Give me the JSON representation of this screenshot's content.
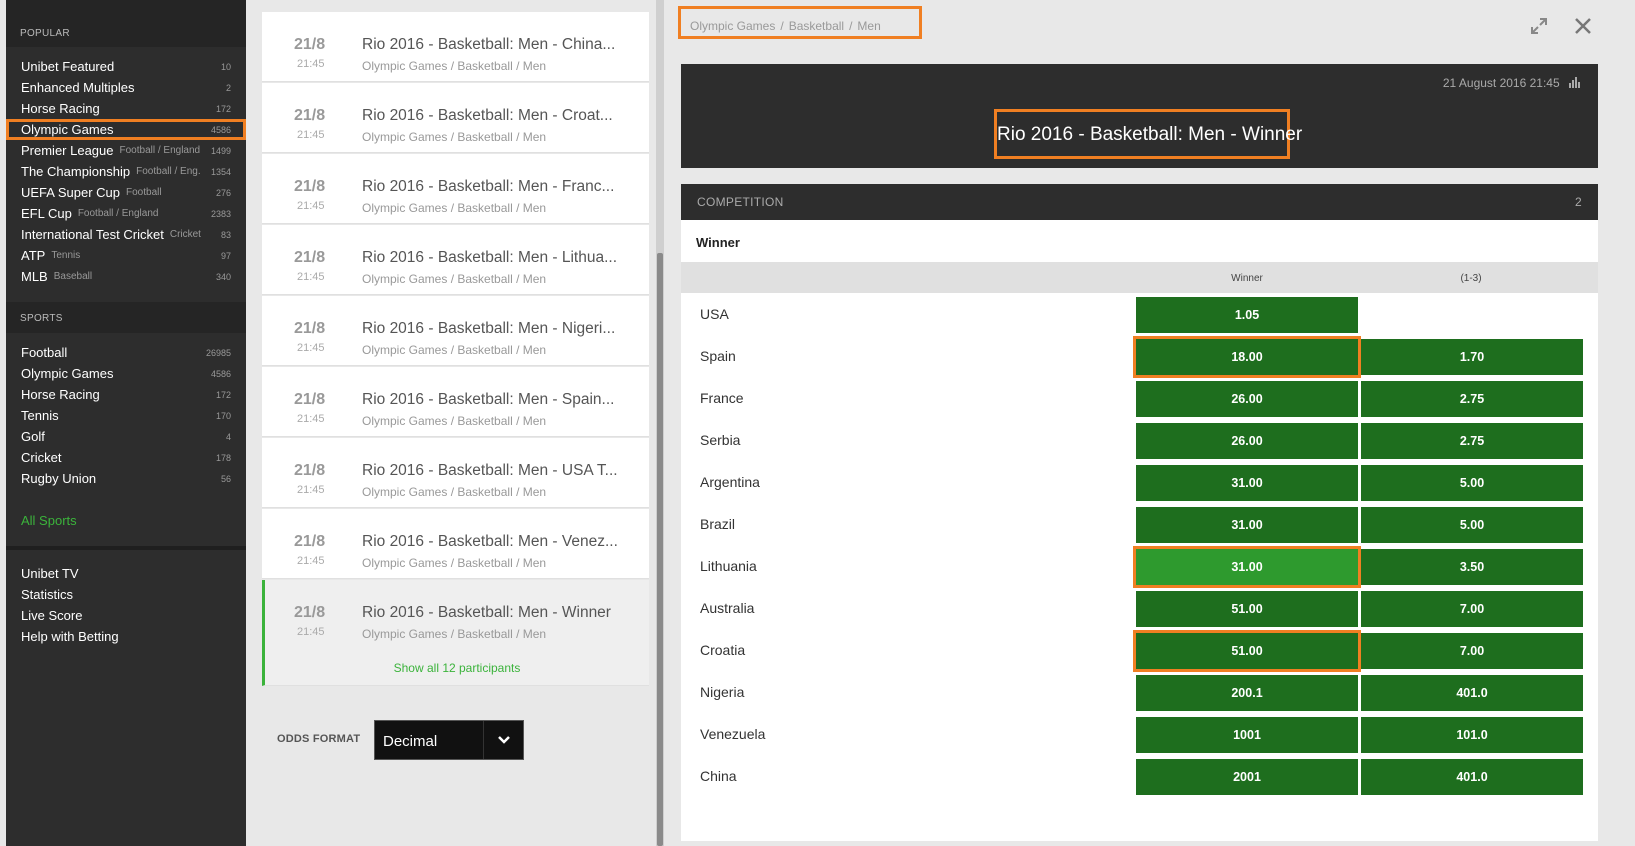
{
  "sidebar": {
    "popular_header": "POPULAR",
    "popular": [
      {
        "label": "Unibet Featured",
        "sub": "",
        "count": "10"
      },
      {
        "label": "Enhanced Multiples",
        "sub": "",
        "count": "2"
      },
      {
        "label": "Horse Racing",
        "sub": "",
        "count": "172"
      },
      {
        "label": "Olympic Games",
        "sub": "",
        "count": "4586"
      },
      {
        "label": "Premier League",
        "sub": "Football / England",
        "count": "1499"
      },
      {
        "label": "The Championship",
        "sub": "Football / Eng.",
        "count": "1354"
      },
      {
        "label": "UEFA Super Cup",
        "sub": "Football",
        "count": "276"
      },
      {
        "label": "EFL Cup",
        "sub": "Football / England",
        "count": "2383"
      },
      {
        "label": "International Test Cricket",
        "sub": "Cricket",
        "count": "83"
      },
      {
        "label": "ATP",
        "sub": "Tennis",
        "count": "97"
      },
      {
        "label": "MLB",
        "sub": "Baseball",
        "count": "340"
      }
    ],
    "sports_header": "SPORTS",
    "sports": [
      {
        "label": "Football",
        "count": "26985"
      },
      {
        "label": "Olympic Games",
        "count": "4586"
      },
      {
        "label": "Horse Racing",
        "count": "172"
      },
      {
        "label": "Tennis",
        "count": "170"
      },
      {
        "label": "Golf",
        "count": "4"
      },
      {
        "label": "Cricket",
        "count": "178"
      },
      {
        "label": "Rugby Union",
        "count": "56"
      }
    ],
    "all_sports": "All Sports",
    "extra": [
      "Unibet TV",
      "Statistics",
      "Live Score",
      "Help with Betting"
    ]
  },
  "events": [
    {
      "date": "21/8",
      "time": "21:45",
      "title": "Rio 2016 - Basketball: Men - China...",
      "path": [
        "Olympic Games",
        "Basketball",
        "Men"
      ]
    },
    {
      "date": "21/8",
      "time": "21:45",
      "title": "Rio 2016 - Basketball: Men - Croat...",
      "path": [
        "Olympic Games",
        "Basketball",
        "Men"
      ]
    },
    {
      "date": "21/8",
      "time": "21:45",
      "title": "Rio 2016 - Basketball: Men - Franc...",
      "path": [
        "Olympic Games",
        "Basketball",
        "Men"
      ]
    },
    {
      "date": "21/8",
      "time": "21:45",
      "title": "Rio 2016 - Basketball: Men - Lithua...",
      "path": [
        "Olympic Games",
        "Basketball",
        "Men"
      ]
    },
    {
      "date": "21/8",
      "time": "21:45",
      "title": "Rio 2016 - Basketball: Men - Nigeri...",
      "path": [
        "Olympic Games",
        "Basketball",
        "Men"
      ]
    },
    {
      "date": "21/8",
      "time": "21:45",
      "title": "Rio 2016 - Basketball: Men - Spain...",
      "path": [
        "Olympic Games",
        "Basketball",
        "Men"
      ]
    },
    {
      "date": "21/8",
      "time": "21:45",
      "title": "Rio 2016 - Basketball: Men - USA T...",
      "path": [
        "Olympic Games",
        "Basketball",
        "Men"
      ]
    },
    {
      "date": "21/8",
      "time": "21:45",
      "title": "Rio 2016 - Basketball: Men - Venez...",
      "path": [
        "Olympic Games",
        "Basketball",
        "Men"
      ]
    },
    {
      "date": "21/8",
      "time": "21:45",
      "title": "Rio 2016 - Basketball: Men - Winner",
      "path": [
        "Olympic Games",
        "Basketball",
        "Men"
      ]
    }
  ],
  "show_all": "Show all 12 participants",
  "odds_format": {
    "label": "ODDS FORMAT",
    "value": "Decimal"
  },
  "detail": {
    "breadcrumb": [
      "Olympic Games",
      "Basketball",
      "Men"
    ],
    "datetime": "21 August 2016 21:45",
    "title": "Rio 2016 - Basketball: Men - Winner",
    "competition_label": "COMPETITION",
    "competition_count": "2",
    "market_title": "Winner",
    "col1": "Winner",
    "col2": "(1-3)",
    "rows": [
      {
        "name": "USA",
        "winner": "1.05",
        "top3": ""
      },
      {
        "name": "Spain",
        "winner": "18.00",
        "top3": "1.70"
      },
      {
        "name": "France",
        "winner": "26.00",
        "top3": "2.75"
      },
      {
        "name": "Serbia",
        "winner": "26.00",
        "top3": "2.75"
      },
      {
        "name": "Argentina",
        "winner": "31.00",
        "top3": "5.00"
      },
      {
        "name": "Brazil",
        "winner": "31.00",
        "top3": "5.00"
      },
      {
        "name": "Lithuania",
        "winner": "31.00",
        "top3": "3.50"
      },
      {
        "name": "Australia",
        "winner": "51.00",
        "top3": "7.00"
      },
      {
        "name": "Croatia",
        "winner": "51.00",
        "top3": "7.00"
      },
      {
        "name": "Nigeria",
        "winner": "200.1",
        "top3": "401.0"
      },
      {
        "name": "Venezuela",
        "winner": "1001",
        "top3": "101.0"
      },
      {
        "name": "China",
        "winner": "2001",
        "top3": "401.0"
      }
    ]
  },
  "colors": {
    "accent_green": "#3bb33b",
    "odds_button": "#1e6e1e",
    "highlight": "#f07f22"
  }
}
